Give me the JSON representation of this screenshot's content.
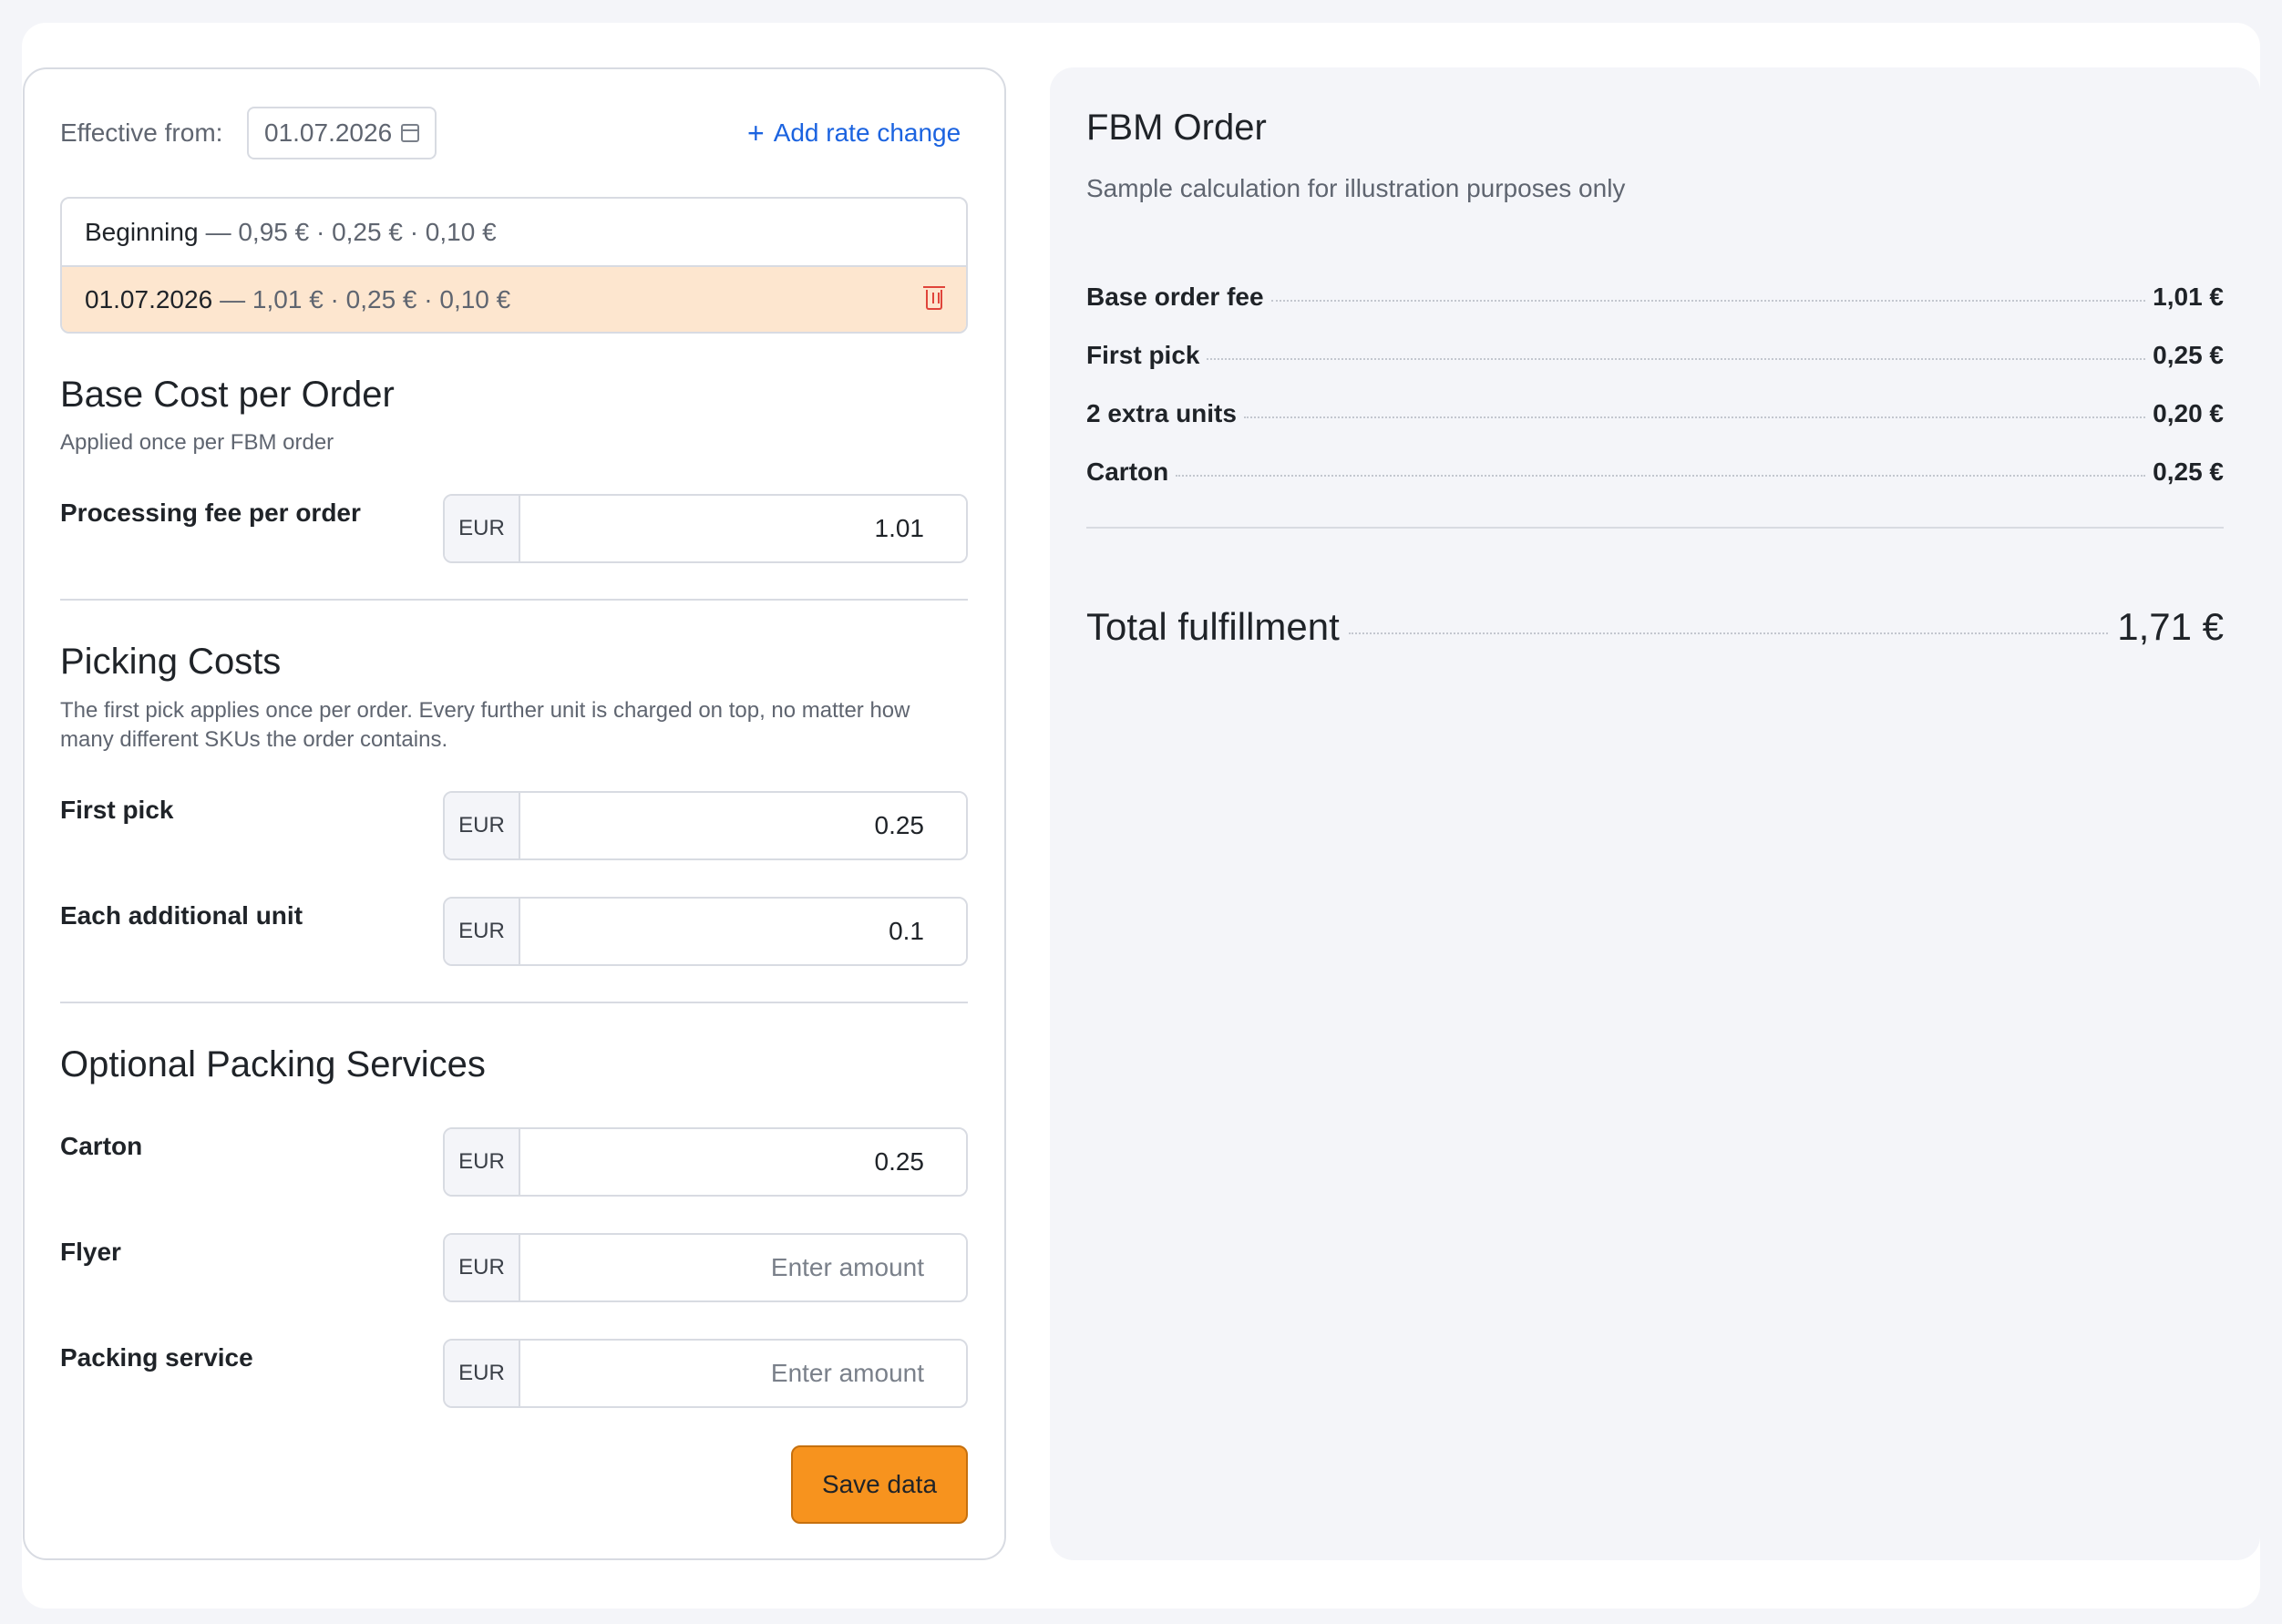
{
  "rates": {
    "effective_label": "Effective from:",
    "effective_date": "01.07.2026",
    "add_rate_label": "Add rate change",
    "history": [
      {
        "date": "Beginning",
        "values": "— 0,95 € · 0,25 € · 0,10 €"
      },
      {
        "date": "01.07.2026",
        "values": "— 1,01 € · 0,25 € · 0,10 €"
      }
    ]
  },
  "base_cost": {
    "title": "Base Cost per Order",
    "subtitle": "Applied once per FBM order",
    "processing_fee_label": "Processing fee per order",
    "currency": "EUR",
    "processing_fee_value": "1.01"
  },
  "picking": {
    "title": "Picking Costs",
    "subtitle": "The first pick applies once per order. Every further unit is charged on top, no matter how many different SKUs the order contains.",
    "first_pick_label": "First pick",
    "first_pick_value": "0.25",
    "additional_unit_label": "Each additional unit",
    "additional_unit_value": "0.1",
    "currency": "EUR"
  },
  "packing": {
    "title": "Optional Packing Services",
    "carton_label": "Carton",
    "carton_value": "0.25",
    "flyer_label": "Flyer",
    "flyer_value": "",
    "packing_service_label": "Packing service",
    "packing_service_value": "",
    "placeholder": "Enter amount",
    "currency": "EUR"
  },
  "save_label": "Save data",
  "calculation": {
    "title": "FBM Order",
    "subtitle": "Sample calculation for illustration purposes only",
    "lines": [
      {
        "label": "Base order fee",
        "value": "1,01 €"
      },
      {
        "label": "First pick",
        "value": "0,25 €"
      },
      {
        "label": "2 extra units",
        "value": "0,20 €"
      },
      {
        "label": "Carton",
        "value": "0,25 €"
      }
    ],
    "total_label": "Total fulfillment",
    "total_value": "1,71 €"
  },
  "colors": {
    "accent": "#1b63e0",
    "save_button": "#f7931e",
    "active_rate_row": "#fde6cf",
    "delete": "#e0443a"
  }
}
